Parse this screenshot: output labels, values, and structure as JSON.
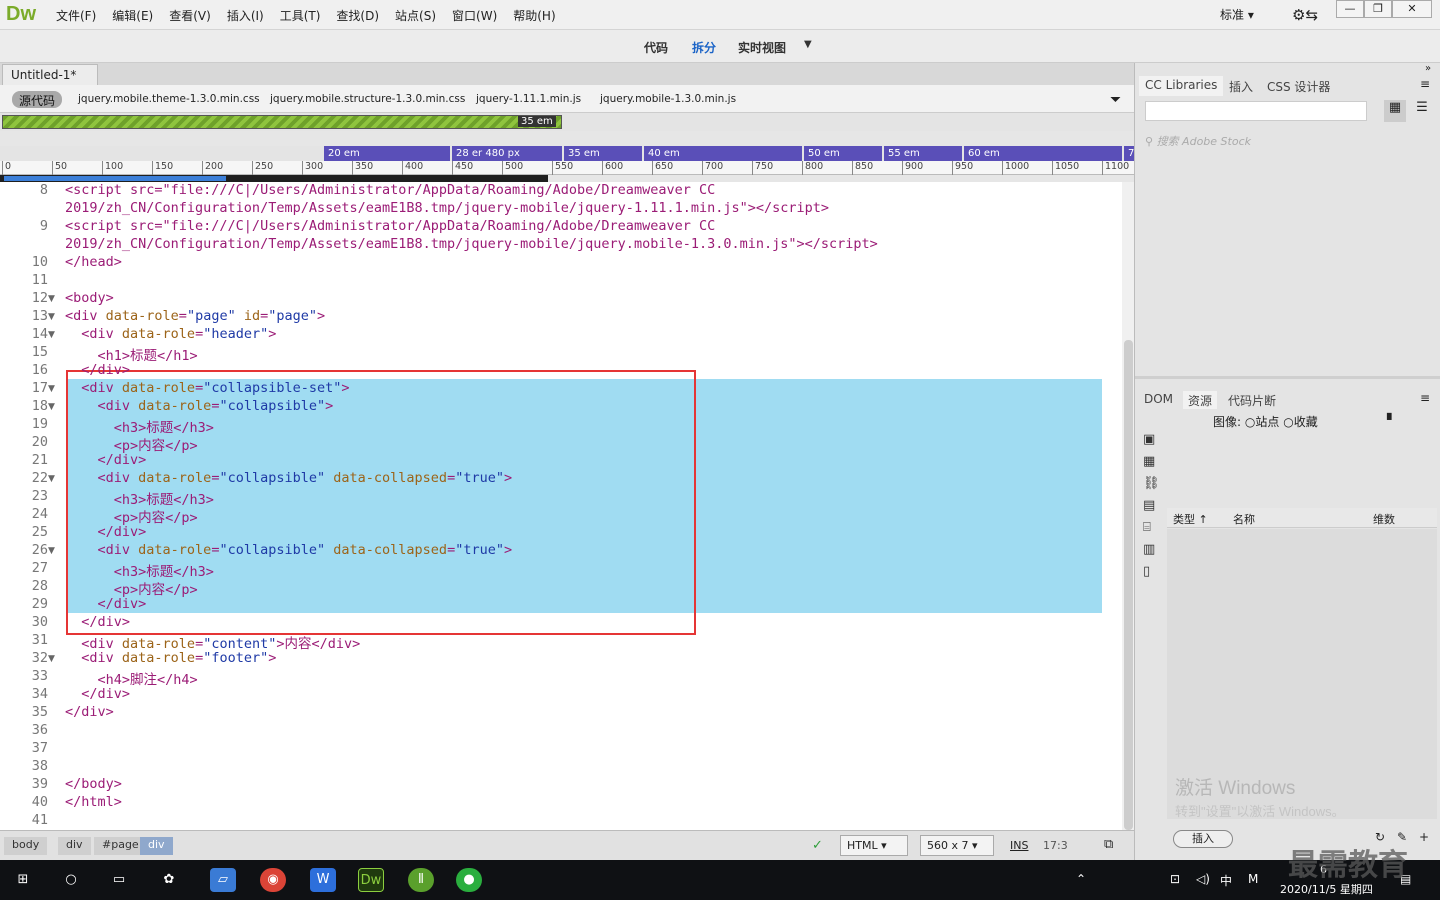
{
  "app": {
    "logo": "Dw",
    "menus": [
      "文件(F)",
      "编辑(E)",
      "查看(V)",
      "插入(I)",
      "工具(T)",
      "查找(D)",
      "站点(S)",
      "窗口(W)",
      "帮助(H)"
    ],
    "workspace": "标准"
  },
  "views": {
    "code": "代码",
    "split": "拆分",
    "live": "实时视图"
  },
  "document": {
    "tab": "Untitled-1*",
    "source_btn": "源代码",
    "related": [
      "jquery.mobile.theme-1.3.0.min.css",
      "jquery.mobile.structure-1.3.0.min.css",
      "jquery-1.11.1.min.js",
      "jquery.mobile-1.3.0.min.js"
    ]
  },
  "media": {
    "green_label": "35 em",
    "segments": [
      "20 em",
      "28 er 480 px",
      "35 em",
      "40 em",
      "50 em",
      "55 em",
      "60 em",
      "7"
    ]
  },
  "ruler": [
    "0",
    "50",
    "100",
    "150",
    "200",
    "250",
    "300",
    "350",
    "400",
    "450",
    "500",
    "550",
    "600",
    "650",
    "700",
    "750",
    "800",
    "850",
    "900",
    "950",
    "1000",
    "1050",
    "1100"
  ],
  "code_lines": [
    {
      "n": "8",
      "fold": false,
      "html": "&lt;script src=\"file:///C|/Users/Administrator/AppData/Roaming/Adobe/Dreamweaver CC"
    },
    {
      "n": "",
      "fold": false,
      "html": "2019/zh_CN/Configuration/Temp/Assets/eamE1B8.tmp/jquery-mobile/jquery-1.11.1.min.js\"&gt;&lt;/script&gt;"
    },
    {
      "n": "9",
      "fold": false,
      "html": "&lt;script src=\"file:///C|/Users/Administrator/AppData/Roaming/Adobe/Dreamweaver CC"
    },
    {
      "n": "",
      "fold": false,
      "html": "2019/zh_CN/Configuration/Temp/Assets/eamE1B8.tmp/jquery-mobile/jquery.mobile-1.3.0.min.js\"&gt;&lt;/script&gt;"
    },
    {
      "n": "10",
      "fold": false,
      "html": "&lt;/head&gt;"
    },
    {
      "n": "11",
      "fold": false,
      "html": ""
    },
    {
      "n": "12",
      "fold": true,
      "html": "&lt;body&gt;"
    },
    {
      "n": "13",
      "fold": true,
      "html": "&lt;div data-role=\"page\" id=\"page\"&gt;"
    },
    {
      "n": "14",
      "fold": true,
      "html": "  &lt;div data-role=\"header\"&gt;"
    },
    {
      "n": "15",
      "fold": false,
      "html": "    &lt;h1&gt;标题&lt;/h1&gt;"
    },
    {
      "n": "16",
      "fold": false,
      "html": "  &lt;/div&gt;"
    },
    {
      "n": "17",
      "fold": true,
      "html": "  &lt;div data-role=\"collapsible-set\"&gt;"
    },
    {
      "n": "18",
      "fold": true,
      "html": "    &lt;div data-role=\"collapsible\"&gt;"
    },
    {
      "n": "19",
      "fold": false,
      "html": "      &lt;h3&gt;标题&lt;/h3&gt;"
    },
    {
      "n": "20",
      "fold": false,
      "html": "      &lt;p&gt;内容&lt;/p&gt;"
    },
    {
      "n": "21",
      "fold": false,
      "html": "    &lt;/div&gt;"
    },
    {
      "n": "22",
      "fold": true,
      "html": "    &lt;div data-role=\"collapsible\" data-collapsed=\"true\"&gt;"
    },
    {
      "n": "23",
      "fold": false,
      "html": "      &lt;h3&gt;标题&lt;/h3&gt;"
    },
    {
      "n": "24",
      "fold": false,
      "html": "      &lt;p&gt;内容&lt;/p&gt;"
    },
    {
      "n": "25",
      "fold": false,
      "html": "    &lt;/div&gt;"
    },
    {
      "n": "26",
      "fold": true,
      "html": "    &lt;div data-role=\"collapsible\" data-collapsed=\"true\"&gt;"
    },
    {
      "n": "27",
      "fold": false,
      "html": "      &lt;h3&gt;标题&lt;/h3&gt;"
    },
    {
      "n": "28",
      "fold": false,
      "html": "      &lt;p&gt;内容&lt;/p&gt;"
    },
    {
      "n": "29",
      "fold": false,
      "html": "    &lt;/div&gt;"
    },
    {
      "n": "30",
      "fold": false,
      "html": "  &lt;/div&gt;"
    },
    {
      "n": "31",
      "fold": false,
      "html": "  &lt;div data-role=\"content\"&gt;内容&lt;/div&gt;"
    },
    {
      "n": "32",
      "fold": true,
      "html": "  &lt;div data-role=\"footer\"&gt;"
    },
    {
      "n": "33",
      "fold": false,
      "html": "    &lt;h4&gt;脚注&lt;/h4&gt;"
    },
    {
      "n": "34",
      "fold": false,
      "html": "  &lt;/div&gt;"
    },
    {
      "n": "35",
      "fold": false,
      "html": "&lt;/div&gt;"
    },
    {
      "n": "36",
      "fold": false,
      "html": ""
    },
    {
      "n": "37",
      "fold": false,
      "html": ""
    },
    {
      "n": "38",
      "fold": false,
      "html": ""
    },
    {
      "n": "39",
      "fold": false,
      "html": "&lt;/body&gt;"
    },
    {
      "n": "40",
      "fold": false,
      "html": "&lt;/html&gt;"
    },
    {
      "n": "41",
      "fold": false,
      "html": ""
    }
  ],
  "status": {
    "crumbs": [
      "body",
      "div",
      "#page",
      "div"
    ],
    "lang": "HTML",
    "size": "560 x 7",
    "mode": "INS",
    "pos": "17:3"
  },
  "panel": {
    "tabs": [
      "CC Libraries",
      "插入",
      "CSS 设计器"
    ],
    "stock": "搜索 Adobe Stock",
    "lower_tabs": [
      "DOM",
      "资源",
      "代码片断"
    ],
    "image_label": "图像:",
    "radio_site": "站点",
    "radio_fav": "收藏",
    "col_type": "类型",
    "col_name": "名称",
    "col_dim": "维数",
    "insert": "插入",
    "watermark1": "激活 Windows",
    "watermark2": "转到\"设置\"以激活 Windows。"
  },
  "taskbar": {
    "date": "2020/11/5 星期四",
    "ime": "中",
    "brand": "最需教育",
    "time_fragment": "6"
  }
}
